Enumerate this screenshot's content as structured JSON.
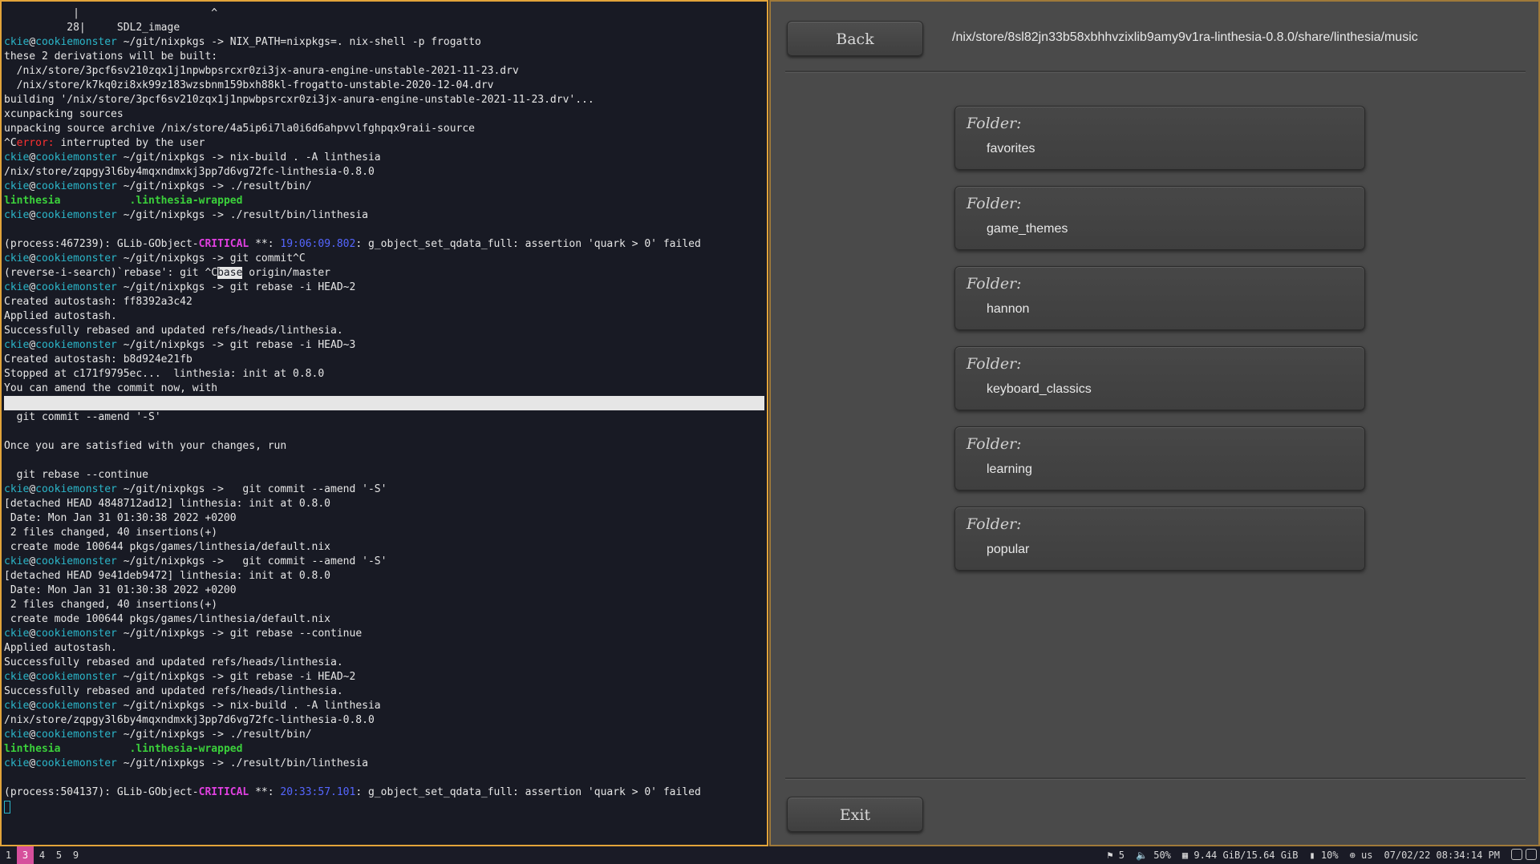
{
  "terminal": {
    "lines": [
      {
        "text": "           |                     ^",
        "type": "plain"
      },
      {
        "text": "          28|     SDL2_image",
        "type": "plain"
      },
      {
        "type": "prompt",
        "user": "ckie",
        "host": "cookiemonster",
        "path": "~/git/nixpkgs",
        "cmd": "NIX_PATH=nixpkgs=. nix-shell -p frogatto"
      },
      {
        "text": "these 2 derivations will be built:",
        "type": "plain"
      },
      {
        "text": "  /nix/store/3pcf6sv210zqx1j1npwbpsrcxr0zi3jx-anura-engine-unstable-2021-11-23.drv",
        "type": "plain"
      },
      {
        "text": "  /nix/store/k7kq0zi8xk99z183wzsbnm159bxh88kl-frogatto-unstable-2020-12-04.drv",
        "type": "plain"
      },
      {
        "text": "building '/nix/store/3pcf6sv210zqx1j1npwbpsrcxr0zi3jx-anura-engine-unstable-2021-11-23.drv'...",
        "type": "plain"
      },
      {
        "text": "xcunpacking sources",
        "type": "plain"
      },
      {
        "text": "unpacking source archive /nix/store/4a5ip6i7la0i6d6ahpvvlfghpqx9raii-source",
        "type": "plain"
      },
      {
        "type": "error",
        "prefix": "^C",
        "label": "error:",
        "rest": " interrupted by the user"
      },
      {
        "type": "prompt",
        "user": "ckie",
        "host": "cookiemonster",
        "path": "~/git/nixpkgs",
        "cmd": "nix-build . -A linthesia"
      },
      {
        "text": "/nix/store/zqpgy3l6by4mqxndmxkj3pp7d6vg72fc-linthesia-0.8.0",
        "type": "plain"
      },
      {
        "type": "prompt",
        "user": "ckie",
        "host": "cookiemonster",
        "path": "~/git/nixpkgs",
        "cmd": "./result/bin/"
      },
      {
        "type": "ls",
        "a": "linthesia",
        "b": ".linthesia-wrapped"
      },
      {
        "type": "prompt",
        "user": "ckie",
        "host": "cookiemonster",
        "path": "~/git/nixpkgs",
        "cmd": "./result/bin/linthesia"
      },
      {
        "text": "",
        "type": "plain"
      },
      {
        "type": "critical",
        "pre": "(process:467239): GLib-GObject-",
        "crit": "CRITICAL",
        "mid": " **: ",
        "ts": "19:06:09.802",
        "post": ": g_object_set_qdata_full: assertion 'quark > 0' failed"
      },
      {
        "type": "prompt",
        "user": "ckie",
        "host": "cookiemonster",
        "path": "~/git/nixpkgs",
        "cmd": "git commit^C"
      },
      {
        "type": "search",
        "pre": "(reverse-i-search)`rebase': git ^C",
        "sel": "base",
        "post": " origin/master"
      },
      {
        "type": "prompt",
        "user": "ckie",
        "host": "cookiemonster",
        "path": "~/git/nixpkgs",
        "cmd": "git rebase -i HEAD~2"
      },
      {
        "text": "Created autostash: ff8392a3c42",
        "type": "plain"
      },
      {
        "text": "Applied autostash.",
        "type": "plain"
      },
      {
        "text": "Successfully rebased and updated refs/heads/linthesia.",
        "type": "plain"
      },
      {
        "type": "prompt",
        "user": "ckie",
        "host": "cookiemonster",
        "path": "~/git/nixpkgs",
        "cmd": "git rebase -i HEAD~3"
      },
      {
        "text": "Created autostash: b8d924e21fb",
        "type": "plain"
      },
      {
        "text": "Stopped at c171f9795ec...  linthesia: init at 0.8.0",
        "type": "plain"
      },
      {
        "text": "You can amend the commit now, with",
        "type": "plain"
      },
      {
        "text": "",
        "type": "highlight"
      },
      {
        "text": "  git commit --amend '-S'",
        "type": "plain"
      },
      {
        "text": "",
        "type": "plain"
      },
      {
        "text": "Once you are satisfied with your changes, run",
        "type": "plain"
      },
      {
        "text": "",
        "type": "plain"
      },
      {
        "text": "  git rebase --continue",
        "type": "plain"
      },
      {
        "type": "prompt",
        "user": "ckie",
        "host": "cookiemonster",
        "path": "~/git/nixpkgs",
        "cmd": "  git commit --amend '-S'"
      },
      {
        "text": "[detached HEAD 4848712ad12] linthesia: init at 0.8.0",
        "type": "plain"
      },
      {
        "text": " Date: Mon Jan 31 01:30:38 2022 +0200",
        "type": "plain"
      },
      {
        "text": " 2 files changed, 40 insertions(+)",
        "type": "plain"
      },
      {
        "text": " create mode 100644 pkgs/games/linthesia/default.nix",
        "type": "plain"
      },
      {
        "type": "prompt",
        "user": "ckie",
        "host": "cookiemonster",
        "path": "~/git/nixpkgs",
        "cmd": "  git commit --amend '-S'"
      },
      {
        "text": "[detached HEAD 9e41deb9472] linthesia: init at 0.8.0",
        "type": "plain"
      },
      {
        "text": " Date: Mon Jan 31 01:30:38 2022 +0200",
        "type": "plain"
      },
      {
        "text": " 2 files changed, 40 insertions(+)",
        "type": "plain"
      },
      {
        "text": " create mode 100644 pkgs/games/linthesia/default.nix",
        "type": "plain"
      },
      {
        "type": "prompt",
        "user": "ckie",
        "host": "cookiemonster",
        "path": "~/git/nixpkgs",
        "cmd": "git rebase --continue"
      },
      {
        "text": "Applied autostash.",
        "type": "plain"
      },
      {
        "text": "Successfully rebased and updated refs/heads/linthesia.",
        "type": "plain"
      },
      {
        "type": "prompt",
        "user": "ckie",
        "host": "cookiemonster",
        "path": "~/git/nixpkgs",
        "cmd": "git rebase -i HEAD~2"
      },
      {
        "text": "Successfully rebased and updated refs/heads/linthesia.",
        "type": "plain"
      },
      {
        "type": "prompt",
        "user": "ckie",
        "host": "cookiemonster",
        "path": "~/git/nixpkgs",
        "cmd": "nix-build . -A linthesia"
      },
      {
        "text": "/nix/store/zqpgy3l6by4mqxndmxkj3pp7d6vg72fc-linthesia-0.8.0",
        "type": "plain"
      },
      {
        "type": "prompt",
        "user": "ckie",
        "host": "cookiemonster",
        "path": "~/git/nixpkgs",
        "cmd": "./result/bin/"
      },
      {
        "type": "ls",
        "a": "linthesia",
        "b": ".linthesia-wrapped"
      },
      {
        "type": "prompt",
        "user": "ckie",
        "host": "cookiemonster",
        "path": "~/git/nixpkgs",
        "cmd": "./result/bin/linthesia"
      },
      {
        "text": "",
        "type": "plain"
      },
      {
        "type": "critical",
        "pre": "(process:504137): GLib-GObject-",
        "crit": "CRITICAL",
        "mid": " **: ",
        "ts": "20:33:57.101",
        "post": ": g_object_set_qdata_full: assertion 'quark > 0' failed"
      },
      {
        "type": "cursor"
      }
    ]
  },
  "app": {
    "back_label": "Back",
    "exit_label": "Exit",
    "path": "/nix/store/8sl82jn33b58xbhhvzixlib9amy9v1ra-linthesia-0.8.0/share/linthesia/music",
    "folder_type_label": "Folder:",
    "folders": [
      {
        "name": "favorites"
      },
      {
        "name": "game_themes"
      },
      {
        "name": "hannon"
      },
      {
        "name": "keyboard_classics"
      },
      {
        "name": "learning"
      },
      {
        "name": "popular"
      }
    ]
  },
  "statusbar": {
    "workspaces": [
      {
        "label": "1",
        "active": false
      },
      {
        "label": "3",
        "active": true
      },
      {
        "label": "4",
        "active": false
      },
      {
        "label": "5",
        "active": false
      },
      {
        "label": "9",
        "active": false
      }
    ],
    "network": "5",
    "volume": "50%",
    "memory": "9.44 GiB/15.64 GiB",
    "disk": "10%",
    "keyboard": "us",
    "datetime": "07/02/22 08:34:14 PM"
  },
  "colors": {
    "accent_border": "#e2a43a",
    "active_workspace": "#d64f9c",
    "prompt_user": "#2bb6c9",
    "error": "#ff3030",
    "critical": "#e040e0"
  }
}
